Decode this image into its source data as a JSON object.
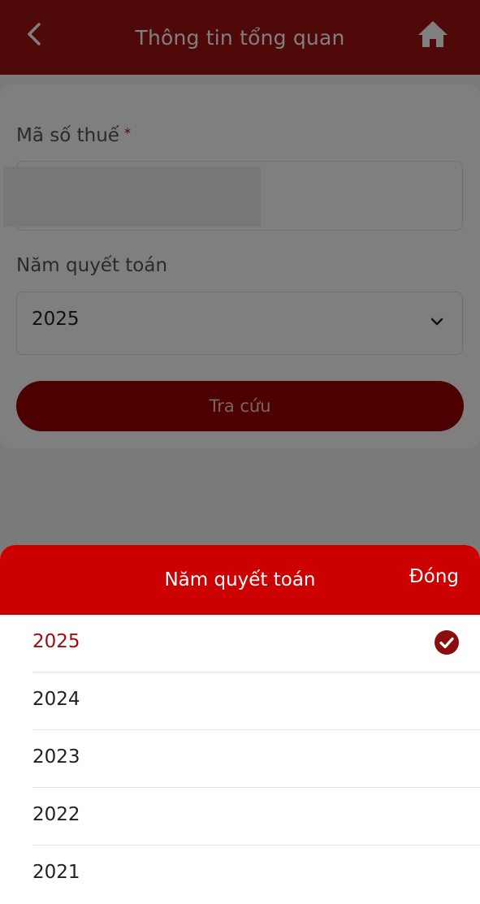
{
  "header": {
    "title": "Thông tin tổng quan"
  },
  "form": {
    "tax_code_label": "Mã số thuế",
    "required_mark": "*",
    "tax_code_value": "",
    "year_label": "Năm quyết toán",
    "year_value": "2025",
    "search_label": "Tra cứu"
  },
  "sheet": {
    "title": "Năm quyết toán",
    "close_label": "Đóng",
    "options": [
      "2025",
      "2024",
      "2023",
      "2022",
      "2021"
    ],
    "selected": "2025"
  },
  "colors": {
    "header": "#a11212",
    "sheet_header": "#cc0000",
    "button": "#980000",
    "selected_text": "#9e0c0c"
  }
}
